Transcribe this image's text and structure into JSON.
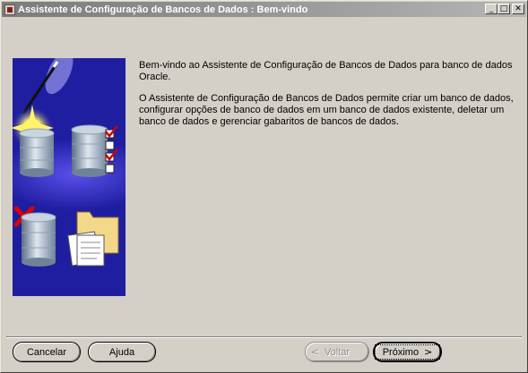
{
  "window": {
    "title": "Assistente de Configuração de Bancos de Dados : Bem-vindo",
    "minimize_glyph": "_",
    "maximize_glyph": "□",
    "close_glyph": "✕"
  },
  "message": {
    "paragraph1": "Bem-vindo ao Assistente de Configuração de Bancos de Dados para banco de dados Oracle.",
    "paragraph2": "O Assistente de Configuração de Bancos de Dados permite criar um banco de dados, configurar opções de banco de dados em um banco de dados existente, deletar um banco de dados e gerenciar gabaritos de bancos de dados."
  },
  "buttons": {
    "cancel": "Cancelar",
    "help": "Ajuda",
    "back": "Voltar",
    "next": "Próximo",
    "back_arrow": "<",
    "next_arrow": ">"
  },
  "icons": {
    "banner": "database-wizard-illustration",
    "title": "app-icon"
  },
  "colors": {
    "banner_background": "#1f1ea0",
    "check": "#cc0000",
    "delete_x": "#e00000"
  }
}
